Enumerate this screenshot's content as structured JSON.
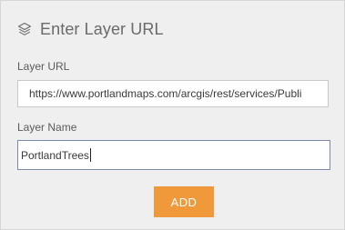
{
  "header": {
    "icon": "layers-icon",
    "title": "Enter Layer URL"
  },
  "form": {
    "url_label": "Layer URL",
    "url_value": "https://www.portlandmaps.com/arcgis/rest/services/Publi",
    "name_label": "Layer Name",
    "name_value": "PortlandTrees",
    "add_label": "ADD"
  },
  "colors": {
    "accent": "#f0993b",
    "panel_bg": "#efefef",
    "focus_border": "#7a8aa8"
  }
}
